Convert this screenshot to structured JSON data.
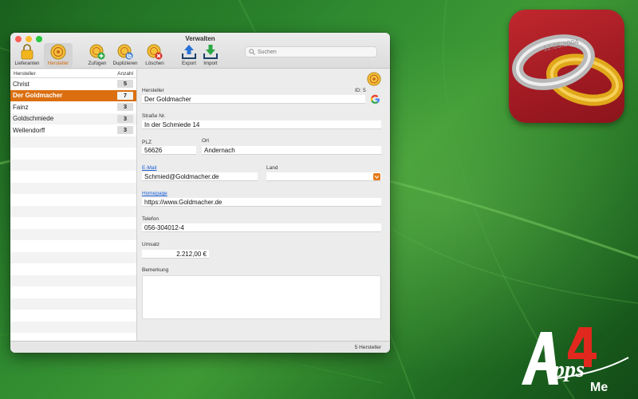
{
  "window": {
    "title": "Verwalten",
    "status": "5 Hersteller"
  },
  "toolbar": {
    "lieferanten": "Lieferanten",
    "hersteller": "Hersteller",
    "zufuegen": "Zufügen",
    "duplizieren": "Duplizieren",
    "loeschen": "Löschen",
    "export": "Export",
    "import": "Import",
    "search_placeholder": "Suchen"
  },
  "list": {
    "col_name": "Hersteller",
    "col_count": "Anzahl",
    "rows": [
      {
        "name": "Christ",
        "count": "5"
      },
      {
        "name": "Der Goldmacher",
        "count": "7"
      },
      {
        "name": "Fainz",
        "count": "3"
      },
      {
        "name": "Goldschmiede",
        "count": "3"
      },
      {
        "name": "Wellendorff",
        "count": "3"
      }
    ],
    "selected_index": 1
  },
  "detail": {
    "hersteller_label": "Hersteller",
    "id_label": "ID: 5",
    "hersteller_value": "Der Goldmacher",
    "strasse_label": "Straße Nr.",
    "strasse_value": "In der Schmiede 14",
    "plz_label": "PLZ",
    "plz_value": "56626",
    "ort_label": "Ort",
    "ort_value": "Andernach",
    "email_label": "E-Mail",
    "email_value": "Schmied@Goldmacher.de",
    "land_label": "Land",
    "land_value": "",
    "homepage_label": "Homepage",
    "homepage_value": "https://www.Goldmacher.de",
    "telefon_label": "Telefon",
    "telefon_value": "056-304012-4",
    "umsatz_label": "Umsatz",
    "umsatz_value": "2.212,00 €",
    "bemerkung_label": "Bemerkung",
    "bemerkung_value": ""
  },
  "app_icon": {
    "ring_engraving": "12.05.2004"
  },
  "brand": {
    "logo_text": "Apps4Me"
  },
  "colors": {
    "accent": "#db6f10",
    "link": "#1a5fd6",
    "app_icon_bg": "#a01a22"
  },
  "icons": [
    "lock-bag-icon",
    "gold-coin-icon",
    "add-icon",
    "duplicate-icon",
    "delete-icon",
    "export-icon",
    "import-icon",
    "search-icon",
    "google-icon",
    "popup-arrow-icon"
  ]
}
